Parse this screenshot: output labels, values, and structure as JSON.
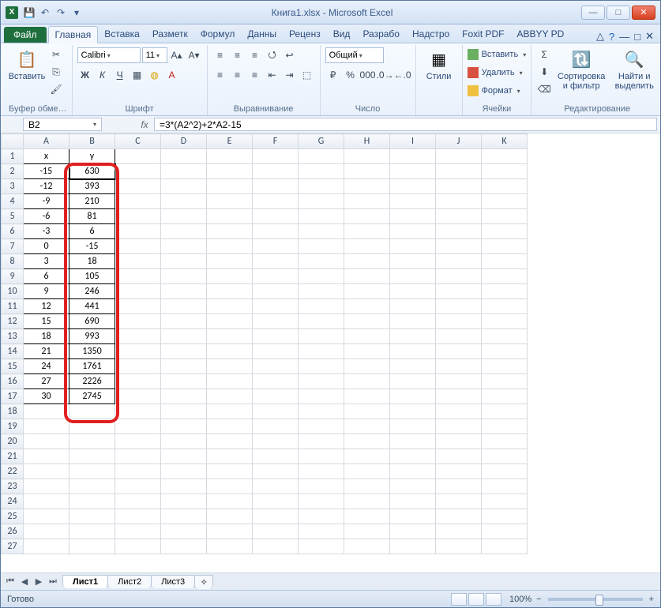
{
  "title": "Книга1.xlsx - Microsoft Excel",
  "qat": {
    "save": "💾",
    "undo": "↶",
    "redo": "↷"
  },
  "tabs": {
    "file": "Файл",
    "items": [
      "Главная",
      "Вставка",
      "Разметк",
      "Формул",
      "Данны",
      "Реценз",
      "Вид",
      "Разрабо",
      "Надстро",
      "Foxit PDF",
      "ABBYY PD"
    ],
    "active": 0
  },
  "ribbon": {
    "clipboard": {
      "paste": "Вставить",
      "label": "Буфер обме…"
    },
    "font": {
      "name": "Calibri",
      "size": "11",
      "label": "Шрифт"
    },
    "align": {
      "label": "Выравнивание"
    },
    "number": {
      "fmt": "Общий",
      "label": "Число"
    },
    "styles": {
      "btn": "Стили",
      "label": ""
    },
    "cells": {
      "insert": "Вставить",
      "delete": "Удалить",
      "format": "Формат",
      "label": "Ячейки"
    },
    "editing": {
      "sort": "Сортировка и фильтр",
      "find": "Найти и выделить",
      "label": "Редактирование"
    }
  },
  "namebox": "B2",
  "formula": "=3*(A2^2)+2*A2-15",
  "columns": [
    "A",
    "B",
    "C",
    "D",
    "E",
    "F",
    "G",
    "H",
    "I",
    "J",
    "K"
  ],
  "rows": [
    1,
    2,
    3,
    4,
    5,
    6,
    7,
    8,
    9,
    10,
    11,
    12,
    13,
    14,
    15,
    16,
    17,
    18,
    19,
    20,
    21,
    22,
    23,
    24,
    25,
    26,
    27
  ],
  "data": {
    "header": {
      "A": "x",
      "B": "y"
    },
    "values": [
      {
        "r": 2,
        "A": "-15",
        "B": "630"
      },
      {
        "r": 3,
        "A": "-12",
        "B": "393"
      },
      {
        "r": 4,
        "A": "-9",
        "B": "210"
      },
      {
        "r": 5,
        "A": "-6",
        "B": "81"
      },
      {
        "r": 6,
        "A": "-3",
        "B": "6"
      },
      {
        "r": 7,
        "A": "0",
        "B": "-15"
      },
      {
        "r": 8,
        "A": "3",
        "B": "18"
      },
      {
        "r": 9,
        "A": "6",
        "B": "105"
      },
      {
        "r": 10,
        "A": "9",
        "B": "246"
      },
      {
        "r": 11,
        "A": "12",
        "B": "441"
      },
      {
        "r": 12,
        "A": "15",
        "B": "690"
      },
      {
        "r": 13,
        "A": "18",
        "B": "993"
      },
      {
        "r": 14,
        "A": "21",
        "B": "1350"
      },
      {
        "r": 15,
        "A": "24",
        "B": "1761"
      },
      {
        "r": 16,
        "A": "27",
        "B": "2226"
      },
      {
        "r": 17,
        "A": "30",
        "B": "2745"
      }
    ]
  },
  "active_cell": "B2",
  "sheets": {
    "items": [
      "Лист1",
      "Лист2",
      "Лист3"
    ],
    "active": 0
  },
  "status": "Готово",
  "zoom": "100%"
}
